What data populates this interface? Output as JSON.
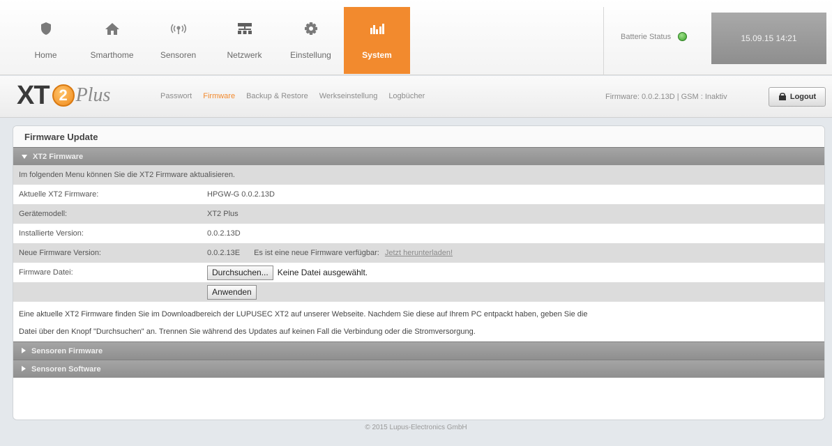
{
  "nav": {
    "items": [
      {
        "label": "Home",
        "icon": "shield-icon"
      },
      {
        "label": "Smarthome",
        "icon": "house-icon"
      },
      {
        "label": "Sensoren",
        "icon": "signal-icon"
      },
      {
        "label": "Netzwerk",
        "icon": "network-icon"
      },
      {
        "label": "Einstellung",
        "icon": "gear-icon"
      },
      {
        "label": "System",
        "icon": "chart-icon"
      }
    ],
    "active": "System"
  },
  "status": {
    "battery_label": "Batterie Status",
    "battery_color": "#3aa32a",
    "datetime": "15.09.15 14:21"
  },
  "logo": {
    "prefix": "XT",
    "badge": "2",
    "suffix": "Plus"
  },
  "subnav": {
    "items": [
      "Passwort",
      "Firmware",
      "Backup & Restore",
      "Werkseinstellung",
      "Logbücher"
    ],
    "active": "Firmware"
  },
  "header_right": {
    "firmware_info": "Firmware: 0.0.2.13D | GSM : Inaktiv",
    "logout_label": "Logout"
  },
  "panel": {
    "title": "Firmware Update",
    "sections": {
      "xt2": "XT2 Firmware",
      "sensor_fw": "Sensoren Firmware",
      "sensor_sw": "Sensoren Software"
    },
    "intro": "Im folgenden Menu können Sie die XT2 Firmware aktualisieren.",
    "rows": {
      "current_label": "Aktuelle XT2 Firmware:",
      "current_value": "HPGW-G 0.0.2.13D",
      "model_label": "Gerätemodell:",
      "model_value": "XT2 Plus",
      "installed_label": "Installierte Version:",
      "installed_value": "0.0.2.13D",
      "new_label": "Neue Firmware Version:",
      "new_value": "0.0.2.13E",
      "new_note": "Es ist eine neue Firmware verfügbar:",
      "download_link": "Jetzt herunterladen!",
      "file_label": "Firmware Datei:",
      "browse_button": "Durchsuchen...",
      "no_file": "Keine Datei ausgewählt.",
      "apply_button": "Anwenden"
    },
    "notice_line1": "Eine aktuelle XT2 Firmware finden Sie im Downloadbereich der LUPUSEC XT2 auf unserer Webseite. Nachdem Sie diese auf Ihrem PC entpackt haben, geben Sie die",
    "notice_line2": "Datei über den Knopf \"Durchsuchen\" an. Trennen Sie während des Updates auf keinen Fall die Verbindung oder die Stromversorgung."
  },
  "footer": "© 2015 Lupus-Electronics GmbH",
  "colors": {
    "accent": "#f28a2e",
    "section": "#999999"
  }
}
